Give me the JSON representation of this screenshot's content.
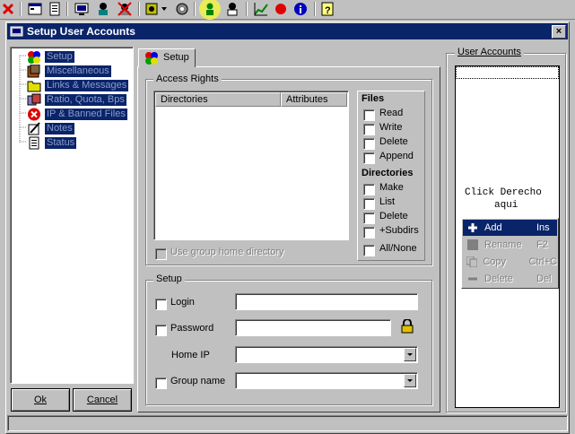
{
  "toolbar": {
    "icons": [
      "stop-icon",
      "window-icon",
      "document-icon",
      "monitor-icon",
      "users-icon",
      "ban-icon",
      "settings-icon",
      "dropdown-icon",
      "gear-icon",
      "user-accounts-icon",
      "user-icon",
      "chart-icon",
      "record-icon",
      "info-icon",
      "help-icon"
    ]
  },
  "window": {
    "title": "Setup User Accounts",
    "close_label": "×"
  },
  "tree": {
    "items": [
      {
        "label": "Setup",
        "icon": "setup-icon"
      },
      {
        "label": "Miscellaneous",
        "icon": "misc-icon"
      },
      {
        "label": "Links & Messages",
        "icon": "folder-icon"
      },
      {
        "label": "Ratio, Quota, Bps",
        "icon": "ratio-icon"
      },
      {
        "label": "IP & Banned Files",
        "icon": "banned-icon"
      },
      {
        "label": "Notes",
        "icon": "notes-icon"
      },
      {
        "label": "Status",
        "icon": "status-icon"
      }
    ]
  },
  "buttons": {
    "ok": "Ok",
    "cancel": "Cancel"
  },
  "tab": {
    "label": "Setup"
  },
  "access_rights": {
    "title": "Access Rights",
    "columns": [
      "Directories",
      "Attributes"
    ],
    "use_group_home": "Use group home directory",
    "files_heading": "Files",
    "files": [
      "Read",
      "Write",
      "Delete",
      "Append"
    ],
    "dirs_heading": "Directories",
    "dirs": [
      "Make",
      "List",
      "Delete",
      "+Subdirs"
    ],
    "all_none": "All/None"
  },
  "setup": {
    "title": "Setup",
    "login_label": "Login",
    "password_label": "Password",
    "home_ip_label": "Home IP",
    "group_name_label": "Group name",
    "login_value": "",
    "password_value": "",
    "home_ip_value": "",
    "group_name_value": ""
  },
  "user_accounts": {
    "title": "User Accounts",
    "hint_line1": "Click Derecho",
    "hint_line2": "aqui"
  },
  "context_menu": {
    "items": [
      {
        "label": "Add",
        "shortcut": "Ins",
        "icon": "plus-icon",
        "state": "selected"
      },
      {
        "label": "Rename",
        "shortcut": "F2",
        "icon": "rename-icon",
        "state": "disabled"
      },
      {
        "label": "Copy",
        "shortcut": "Ctrl+C",
        "icon": "copy-icon",
        "state": "disabled"
      },
      {
        "label": "Delete",
        "shortcut": "Del",
        "icon": "minus-icon",
        "state": "disabled"
      }
    ]
  },
  "colors": {
    "titlebar": "#0a246a",
    "face": "#c0c0c0",
    "highlight": "#e9ec5a"
  }
}
